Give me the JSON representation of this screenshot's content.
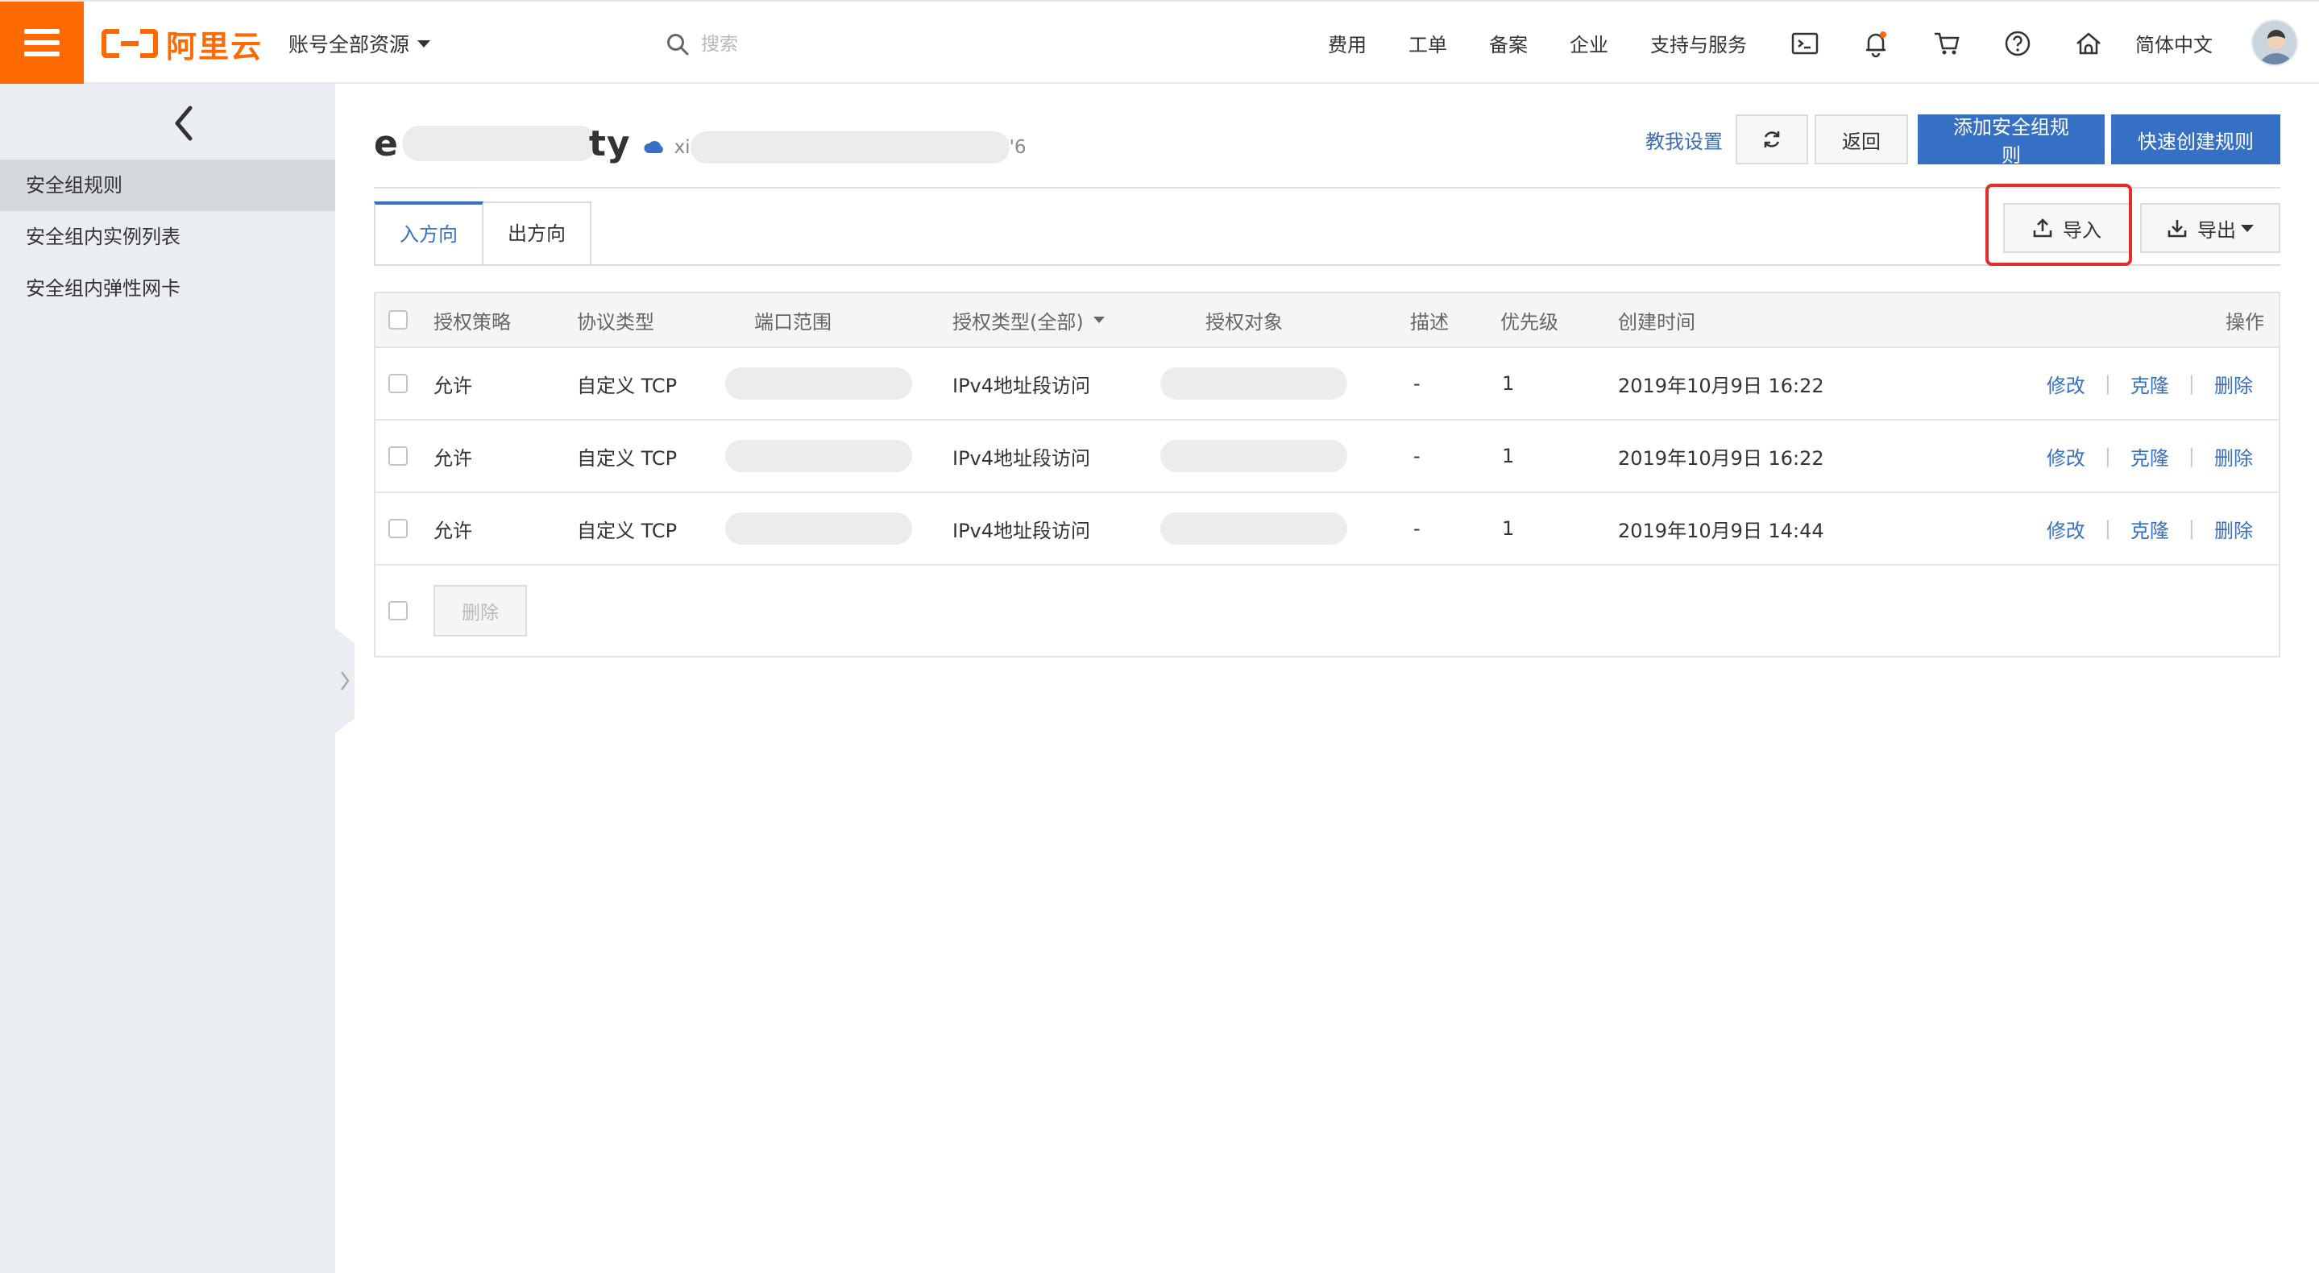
{
  "header": {
    "logo_text": "阿里云",
    "account_scope": "账号全部资源",
    "search_placeholder": "搜索",
    "nav": [
      "费用",
      "工单",
      "备案",
      "企业",
      "支持与服务"
    ],
    "language": "简体中文",
    "brand_color": "#ff6a00"
  },
  "sidebar": {
    "items": [
      {
        "label": "安全组规则",
        "active": true
      },
      {
        "label": "安全组内实例列表",
        "active": false
      },
      {
        "label": "安全组内弹性网卡",
        "active": false
      }
    ]
  },
  "page": {
    "title_visible_start": "e",
    "title_visible_end": "ty",
    "region_prefix": "xi",
    "region_suffix": "'6",
    "help_link": "教我设置",
    "back_label": "返回",
    "add_rule_label": "添加安全组规则",
    "quick_create_label": "快速创建规则",
    "import_label": "导入",
    "export_label": "导出",
    "accent_color": "#3670c5"
  },
  "tabs": [
    {
      "label": "入方向",
      "active": true
    },
    {
      "label": "出方向",
      "active": false
    }
  ],
  "table": {
    "columns": [
      "授权策略",
      "协议类型",
      "端口范围",
      "授权类型(全部)",
      "授权对象",
      "描述",
      "优先级",
      "创建时间",
      "操作"
    ],
    "rows": [
      {
        "policy": "允许",
        "protocol": "自定义 TCP",
        "auth_type": "IPv4地址段访问",
        "desc": "-",
        "priority": "1",
        "created": "2019年10月9日 16:22"
      },
      {
        "policy": "允许",
        "protocol": "自定义 TCP",
        "auth_type": "IPv4地址段访问",
        "desc": "-",
        "priority": "1",
        "created": "2019年10月9日 16:22"
      },
      {
        "policy": "允许",
        "protocol": "自定义 TCP",
        "auth_type": "IPv4地址段访问",
        "desc": "-",
        "priority": "1",
        "created": "2019年10月9日 14:44"
      }
    ],
    "row_actions": [
      "修改",
      "克隆",
      "删除"
    ],
    "bulk_delete_label": "删除"
  }
}
